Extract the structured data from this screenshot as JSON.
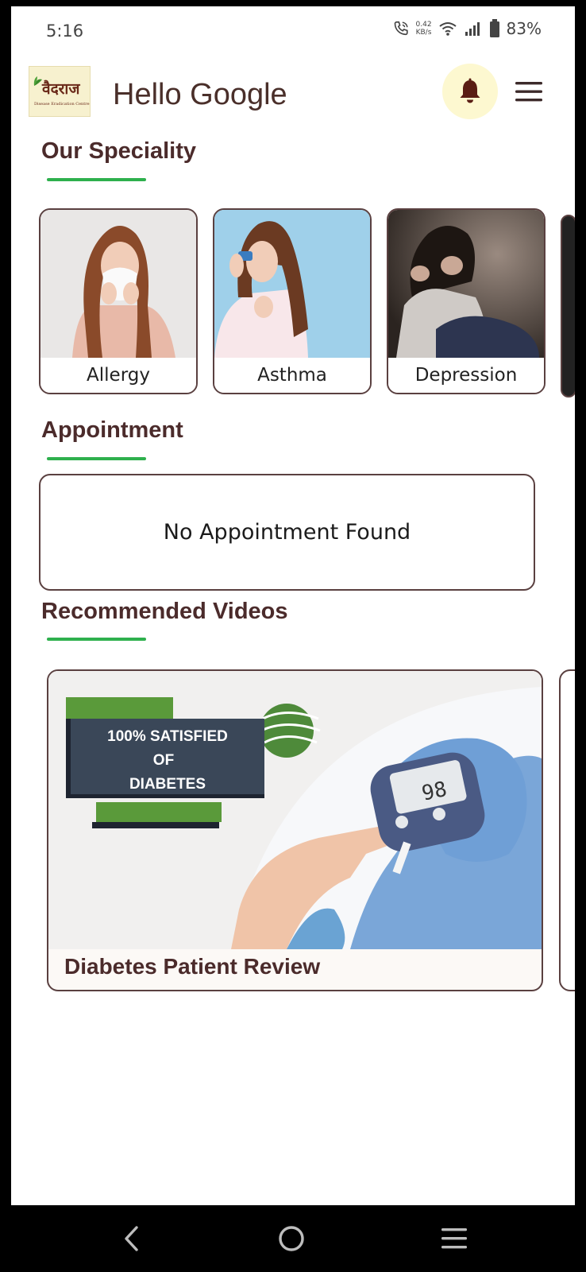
{
  "status_bar": {
    "time": "5:16",
    "net_speed_value": "0.42",
    "net_speed_unit": "KB/s",
    "battery": "83%"
  },
  "header": {
    "logo_text": "वैदराज",
    "logo_subtext": "Disease Eradication Centre",
    "greeting": "Hello Google",
    "bell_icon": "bell-icon",
    "menu_icon": "hamburger-menu-icon"
  },
  "sections": {
    "speciality": "Our Speciality",
    "appointment": "Appointment",
    "videos": "Recommended Videos"
  },
  "specialities": [
    {
      "label": "Allergy"
    },
    {
      "label": "Asthma"
    },
    {
      "label": "Depression"
    }
  ],
  "appointment": {
    "empty_text": "No Appointment Found"
  },
  "videos": [
    {
      "title": "Diabetes Patient Review",
      "banner_line1": "100% SATISFIED",
      "banner_line2": "OF",
      "banner_line3": "DIABETES",
      "meter_reading": "98"
    }
  ],
  "nav": {
    "back_icon": "back-chevron-icon",
    "home_icon": "home-circle-icon",
    "recents_icon": "recents-menu-icon"
  },
  "colors": {
    "accent_green": "#2eb04d",
    "heading_brown": "#4b2b2b",
    "bell_bg": "#fdf8d0"
  }
}
